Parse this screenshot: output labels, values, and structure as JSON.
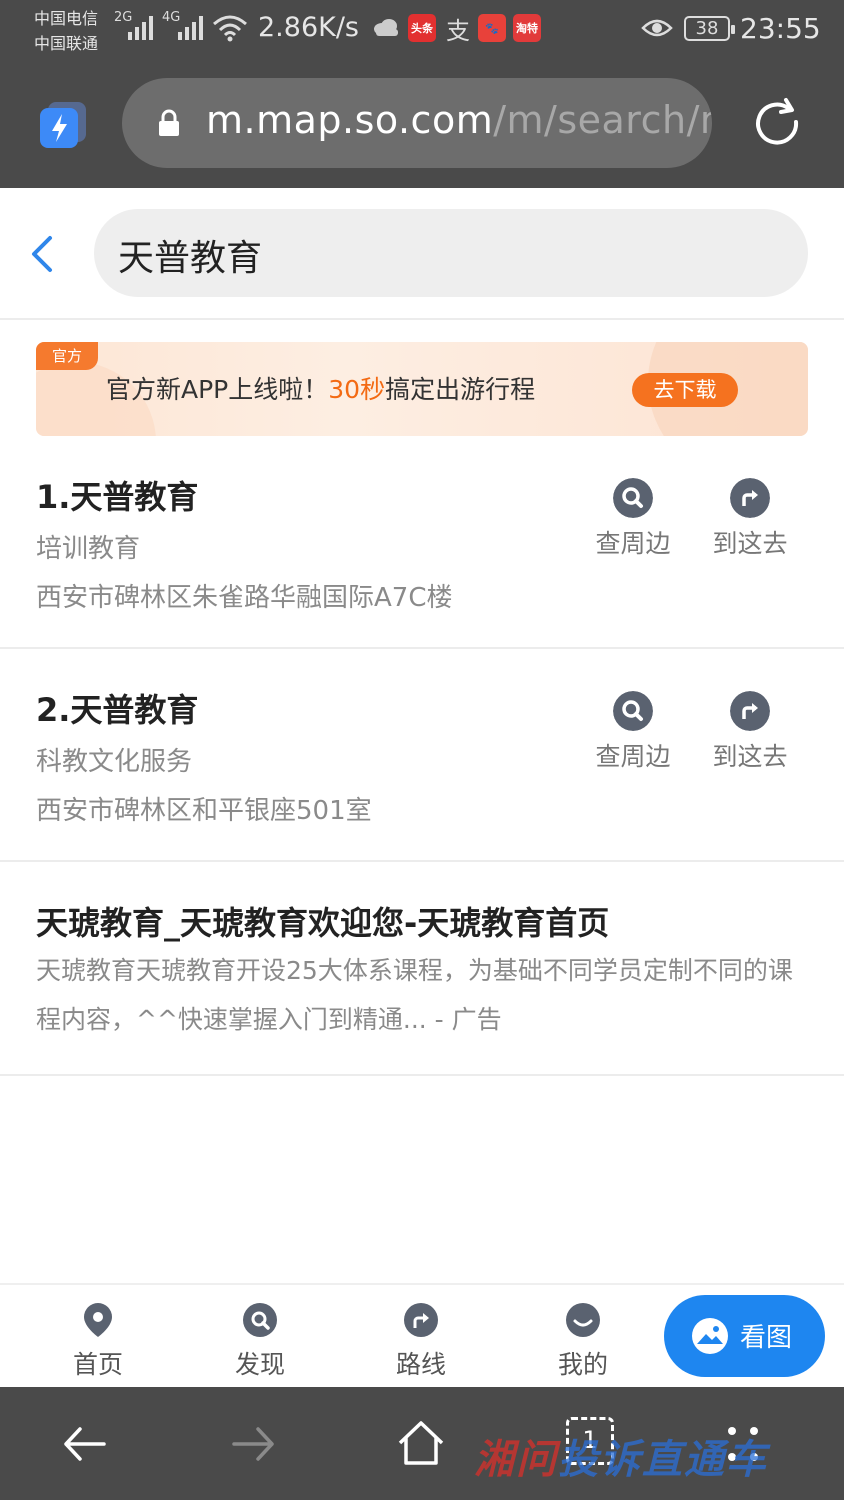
{
  "status_bar": {
    "carrier_1": "中国电信",
    "carrier_2": "中国联通",
    "sig_1": "2G",
    "sig_2": "4G",
    "net_speed": "2.86K/s",
    "apps": [
      "头条",
      "支",
      "🐾",
      "淘特"
    ],
    "battery": "38",
    "time": "23:55"
  },
  "browser": {
    "url_host": "m.map.so.com",
    "url_path": "/m/search/m"
  },
  "search": {
    "query": "天普教育"
  },
  "banner": {
    "tag": "官方",
    "text_before": "官方新APP上线啦！",
    "text_highlight": "30秒",
    "text_after": "搞定出游行程",
    "button": "去下载"
  },
  "results": [
    {
      "title": "1.天普教育",
      "category": "培训教育",
      "address": "西安市碑林区朱雀路华融国际A7C楼",
      "nearby_label": "查周边",
      "goto_label": "到这去"
    },
    {
      "title": "2.天普教育",
      "category": "科教文化服务",
      "address": "西安市碑林区和平银座501室",
      "nearby_label": "查周边",
      "goto_label": "到这去"
    }
  ],
  "ad": {
    "title": "天琥教育_天琥教育欢迎您-天琥教育首页",
    "description": "天琥教育天琥教育开设25大体系课程，为基础不同学员定制不同的课程内容，^^快速掌握入门到精通... - 广告"
  },
  "tabbar": {
    "home": "首页",
    "discover": "发现",
    "route": "路线",
    "mine": "我的",
    "view_map": "看图"
  },
  "system_nav": {
    "tab_count": "1",
    "watermark_red": "湘问",
    "watermark_blue": "投诉直通车"
  },
  "colors": {
    "accent_blue": "#1e86f0",
    "banner_orange": "#f5721f",
    "chrome_gray": "#4a4a4a"
  }
}
